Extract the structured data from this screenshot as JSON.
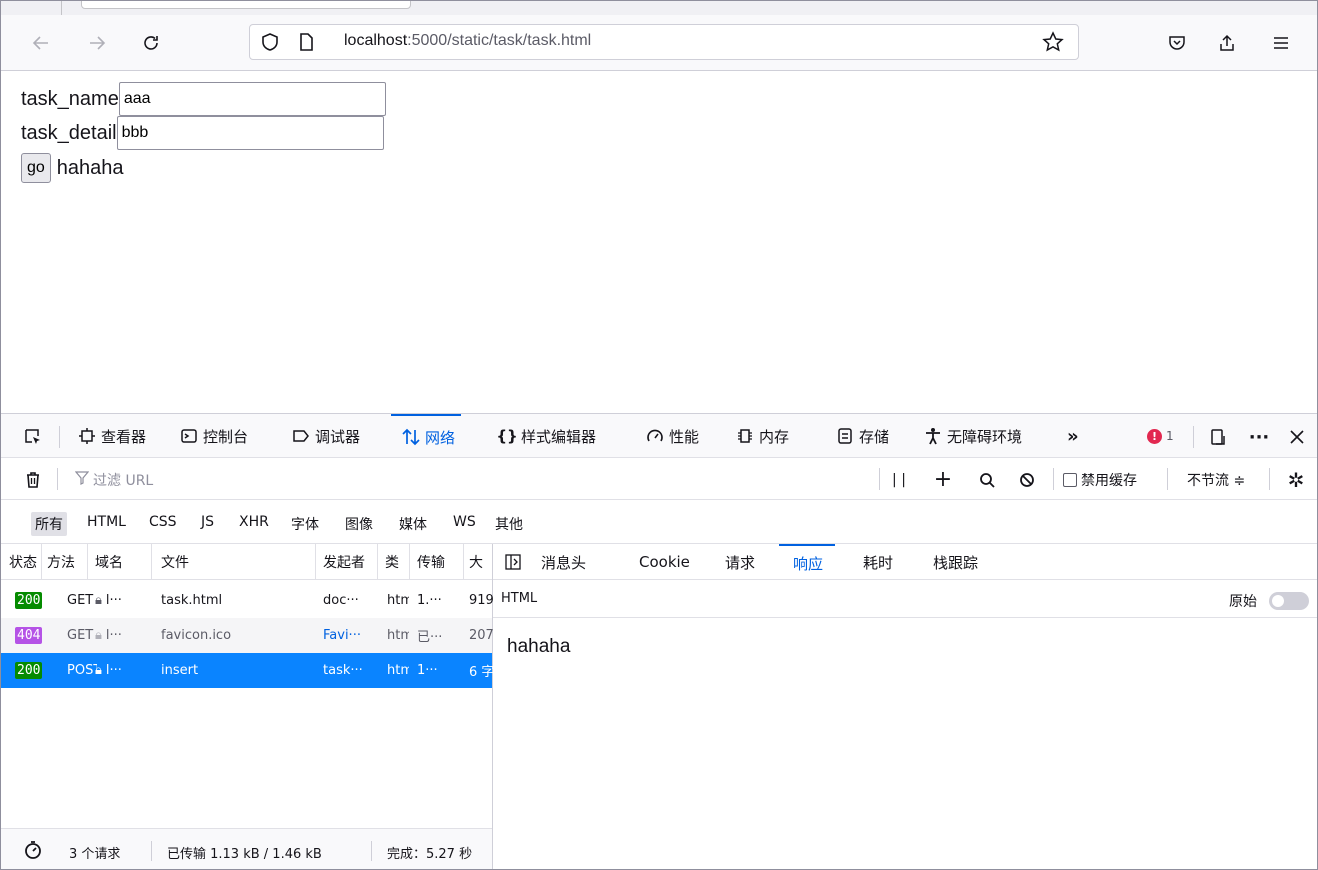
{
  "browser": {
    "url_host": "localhost",
    "url_path": ":5000/static/task/task.html"
  },
  "page": {
    "task_name_label": "task_name",
    "task_name_value": "aaa",
    "task_detail_label": "task_detail",
    "task_detail_value": "bbb",
    "go_label": "go",
    "result_text": "hahaha"
  },
  "devtools": {
    "tabs": [
      "查看器",
      "控制台",
      "调试器",
      "网络",
      "样式编辑器",
      "性能",
      "内存",
      "存储",
      "无障碍环境"
    ],
    "error_count": "1",
    "filter_placeholder": "过滤 URL",
    "disable_cache_label": "禁用缓存",
    "throttle_label": "不节流 ≑",
    "type_filters": [
      "所有",
      "HTML",
      "CSS",
      "JS",
      "XHR",
      "字体",
      "图像",
      "媒体",
      "WS",
      "其他"
    ],
    "columns": [
      "状态",
      "方法",
      "域名",
      "文件",
      "发起者",
      "类",
      "传输",
      "大"
    ],
    "requests": [
      {
        "status": "200",
        "status_color": "#058b00",
        "method": "GET",
        "domain": "l···",
        "file": "task.html",
        "initiator": "doc···",
        "type": "htm",
        "transferred": "1.···",
        "size": "919"
      },
      {
        "status": "404",
        "status_color": "#b553e6",
        "method": "GET",
        "domain": "l···",
        "file": "favicon.ico",
        "initiator": "Favi···",
        "type": "htm",
        "transferred": "已···",
        "size": "207"
      },
      {
        "status": "200",
        "status_color": "#058b00",
        "method": "POST",
        "domain": "l···",
        "file": "insert",
        "initiator": "task···",
        "type": "htm",
        "transferred": "1···",
        "size": "6 字"
      }
    ],
    "footer": {
      "requests": "3 个请求",
      "transferred": "已传输 1.13 kB / 1.46 kB",
      "finished": "完成：5.27 秒"
    },
    "detail_tabs": [
      "消息头",
      "Cookie",
      "请求",
      "响应",
      "耗时",
      "栈跟踪"
    ],
    "detail_sub_label": "HTML",
    "raw_label": "原始",
    "response_body": "hahaha"
  }
}
